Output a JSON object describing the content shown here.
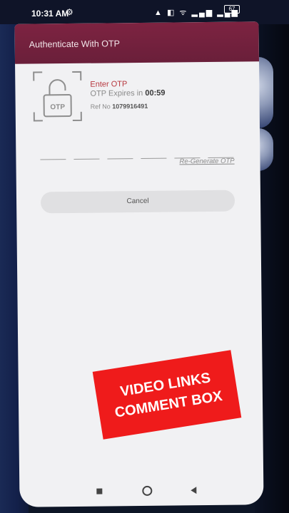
{
  "status_bar": {
    "time": "10:31 AM",
    "settings_glyph": "⚙",
    "signal_glyphs": "▲ ◧ ᯤ ▂▄▆ ▂▄▆",
    "battery_level": "67"
  },
  "app_bar": {
    "title": "Authenticate With OTP"
  },
  "otp_panel": {
    "lock_label": "OTP",
    "enter_label": "Enter OTP",
    "expires_prefix": "OTP Expires in",
    "expires_time": "00:59",
    "ref_prefix": "Ref No",
    "ref_value": "1079916491",
    "digit_count": 6,
    "regenerate_label": "Re-Generate OTP",
    "cancel_label": "Cancel"
  },
  "overlay_banner": {
    "line1": "VIDEO LINKS",
    "line2": "COMMENT BOX"
  },
  "colors": {
    "app_bar": "#6a1f3a",
    "accent_label": "#b7383f",
    "banner": "#ef1b1b",
    "surface": "#f1f1f3"
  },
  "icons": [
    "settings-icon",
    "lock-icon",
    "back-icon",
    "home-icon",
    "recent-icon"
  ]
}
